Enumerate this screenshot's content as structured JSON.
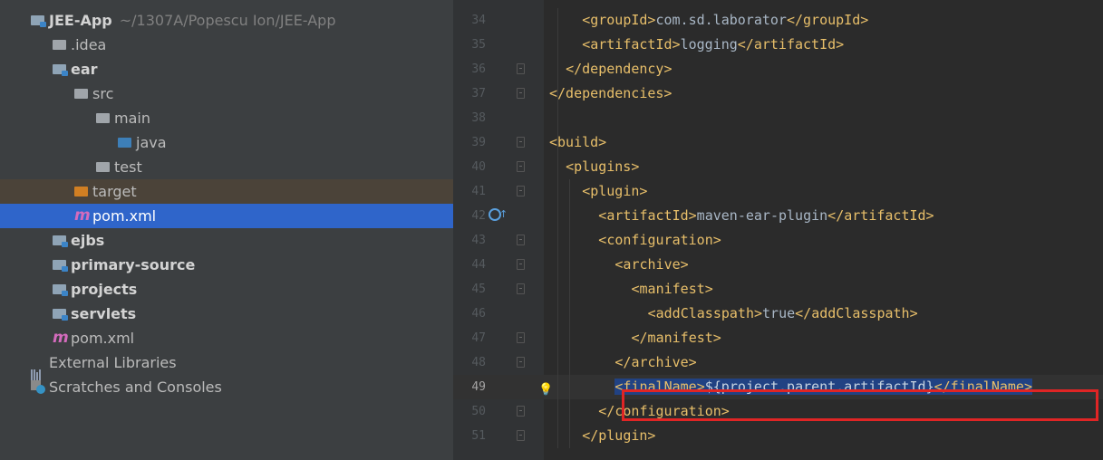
{
  "colors": {
    "tree_bg": "#3c3f41",
    "selection": "#2f65ca",
    "editor_bg": "#2b2b2b",
    "tag": "#e8bf6a",
    "text": "#a9b7c6",
    "highlight_box": "#e02525"
  },
  "project_tree": {
    "items": [
      {
        "chevron": "∨",
        "icon": "module-folder-icon",
        "label": "JEE-App",
        "path": "~/1307A/Popescu Ion/JEE-App",
        "bold": true
      },
      {
        "chevron": "›",
        "icon": "folder-icon",
        "label": ".idea"
      },
      {
        "chevron": "∨",
        "icon": "module-folder-icon",
        "label": "ear",
        "bold": true
      },
      {
        "chevron": "∨",
        "icon": "folder-icon",
        "label": "src"
      },
      {
        "chevron": "∨",
        "icon": "folder-icon",
        "label": "main"
      },
      {
        "chevron": "",
        "icon": "source-folder-icon",
        "label": "java"
      },
      {
        "chevron": "›",
        "icon": "folder-icon",
        "label": "test"
      },
      {
        "chevron": "›",
        "icon": "excluded-folder-icon",
        "label": "target"
      },
      {
        "chevron": "",
        "icon": "maven-icon",
        "label": "pom.xml",
        "selected": true
      },
      {
        "chevron": "›",
        "icon": "module-folder-icon",
        "label": "ejbs",
        "bold": true
      },
      {
        "chevron": "›",
        "icon": "module-folder-icon",
        "label": "primary-source",
        "bold": true
      },
      {
        "chevron": "›",
        "icon": "module-folder-icon",
        "label": "projects",
        "bold": true
      },
      {
        "chevron": "›",
        "icon": "module-folder-icon",
        "label": "servlets",
        "bold": true
      },
      {
        "chevron": "",
        "icon": "maven-icon",
        "label": "pom.xml"
      },
      {
        "chevron": "›",
        "icon": "libraries-icon",
        "label": "External Libraries"
      },
      {
        "chevron": "",
        "icon": "scratches-icon",
        "label": "Scratches and Consoles"
      }
    ]
  },
  "editor": {
    "lines": [
      {
        "num": "34",
        "code": "<groupId>com.sd.laborator</groupId>"
      },
      {
        "num": "35",
        "code": "<artifactId>logging</artifactId>"
      },
      {
        "num": "36",
        "code": "</dependency>"
      },
      {
        "num": "37",
        "code": "</dependencies>"
      },
      {
        "num": "38",
        "code": ""
      },
      {
        "num": "39",
        "code": "<build>"
      },
      {
        "num": "40",
        "code": "<plugins>"
      },
      {
        "num": "41",
        "code": "<plugin>"
      },
      {
        "num": "42",
        "code": "<artifactId>maven-ear-plugin</artifactId>"
      },
      {
        "num": "43",
        "code": "<configuration>"
      },
      {
        "num": "44",
        "code": "<archive>"
      },
      {
        "num": "45",
        "code": "<manifest>"
      },
      {
        "num": "46",
        "code": "<addClasspath>true</addClasspath>"
      },
      {
        "num": "47",
        "code": "</manifest>"
      },
      {
        "num": "48",
        "code": "</archive>"
      },
      {
        "num": "49",
        "code": "<finalName>${project.parent.artifactId}</finalName>"
      },
      {
        "num": "50",
        "code": "</configuration>"
      },
      {
        "num": "51",
        "code": "</plugin>"
      }
    ]
  }
}
